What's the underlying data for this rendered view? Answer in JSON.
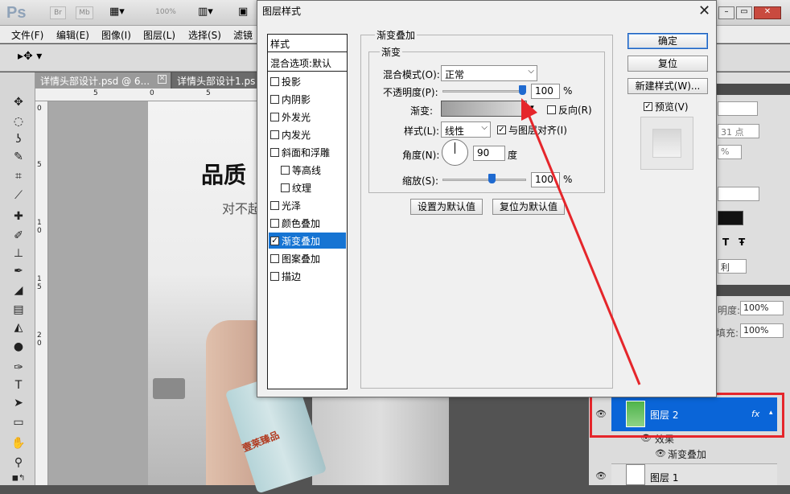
{
  "app": {
    "logo": "Ps",
    "chips": [
      "Br",
      "Mb",
      "100%"
    ]
  },
  "menu": [
    "文件(F)",
    "编辑(E)",
    "图像(I)",
    "图层(L)",
    "选择(S)",
    "滤镜"
  ],
  "tabs": [
    "详情头部设计.psd @ 6...",
    "详情头部设计1.ps"
  ],
  "ruler": {
    "top": [
      "5",
      "0",
      "5"
    ],
    "left": [
      "0",
      "5",
      "1",
      "0",
      "1",
      "5",
      "2",
      "0"
    ]
  },
  "canvas": {
    "title": "品质",
    "subtitle": "对不起",
    "bottle_text": "壹莱臻品"
  },
  "right_panel": {
    "field_pt": "31 点",
    "field_pct": "%",
    "text_t": "T",
    "text_f": "Ŧ",
    "label_li": "利"
  },
  "layers": {
    "opacity_label": "明度:",
    "opacity": "100%",
    "fill_label": "填充:",
    "fill": "100%",
    "layer2": "图层 2",
    "fx": "fx",
    "effects": "效果",
    "effect_item": "渐变叠加",
    "layer1": "图层 1"
  },
  "dialog": {
    "title": "图层样式",
    "close": "✕",
    "styles_header": "样式",
    "blend_default": "混合选项:默认",
    "items": [
      {
        "label": "投影",
        "checked": false
      },
      {
        "label": "内阴影",
        "checked": false
      },
      {
        "label": "外发光",
        "checked": false
      },
      {
        "label": "内发光",
        "checked": false
      },
      {
        "label": "斜面和浮雕",
        "checked": false
      },
      {
        "label": "等高线",
        "checked": false
      },
      {
        "label": "纹理",
        "checked": false
      },
      {
        "label": "光泽",
        "checked": false
      },
      {
        "label": "颜色叠加",
        "checked": false
      },
      {
        "label": "渐变叠加",
        "checked": true
      },
      {
        "label": "图案叠加",
        "checked": false
      },
      {
        "label": "描边",
        "checked": false
      }
    ],
    "section_title": "渐变叠加",
    "group_title": "渐变",
    "blend_mode_label": "混合模式(O):",
    "blend_mode_value": "正常",
    "opacity_label": "不透明度(P):",
    "opacity_value": "100",
    "opacity_level": 1.0,
    "percent": "%",
    "gradient_label": "渐变:",
    "reverse_label": "反向(R)",
    "reverse_checked": false,
    "style_label": "样式(L):",
    "style_value": "线性",
    "align_label": "与图层对齐(I)",
    "align_checked": true,
    "angle_label": "角度(N):",
    "angle_value": "90",
    "degree": "度",
    "scale_label": "缩放(S):",
    "scale_value": "100",
    "scale_level": 0.6,
    "set_default": "设置为默认值",
    "reset_default": "复位为默认值",
    "ok": "确定",
    "reset": "复位",
    "new_style": "新建样式(W)...",
    "preview_label": "预览(V)",
    "preview_checked": true
  },
  "colors": {
    "accent": "#1674d3",
    "highlight": "#e5262b",
    "layer_selected": "#0a65d8"
  }
}
